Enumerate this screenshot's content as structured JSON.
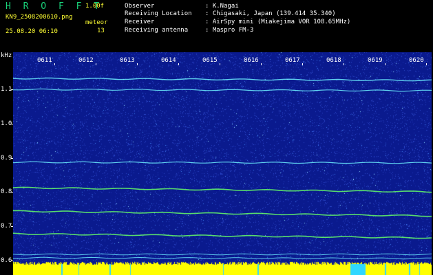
{
  "header": {
    "logo_text": "HROFFT",
    "version": "1.00f",
    "filename": "KN9_2508200610.png",
    "mode": "meteor",
    "timestamp": "25.08.20 06:10",
    "count": "13"
  },
  "station_info": [
    {
      "label": "Observer",
      "value": ": K.Nagai"
    },
    {
      "label": "Receiving Location",
      "value": ": Chigasaki, Japan (139.414 35.340)"
    },
    {
      "label": "Receiver",
      "value": ": AirSpy mini (Miakejima VOR 108.65MHz)"
    },
    {
      "label": "Receiving antenna",
      "value": ": Maspro FM-3"
    }
  ],
  "axis": {
    "unit": "kHz",
    "y_labels": [
      "1.1",
      "1.0",
      "0.9",
      "0.8",
      "0.7",
      "0.6"
    ],
    "time_labels": [
      "0611",
      "0612",
      "0613",
      "0614",
      "0615",
      "0616",
      "0617",
      "0618",
      "0619",
      "0620"
    ]
  },
  "colors": {
    "background": "#0a1a8e",
    "label_green": "#19d27a",
    "label_yellow": "#ffff33",
    "signal_cyan": "#6df0ff",
    "signal_green": "#66ff66",
    "level_yellow": "#ffff00"
  }
}
